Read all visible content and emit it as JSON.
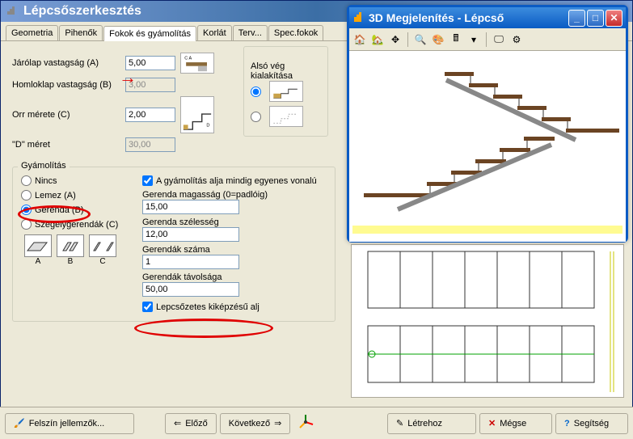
{
  "mainTitle": "Lépcsőszerkesztés",
  "tabs": [
    "Geometria",
    "Pihenők",
    "Fokok és gyámolítás",
    "Korlát",
    "Terv...",
    "Spec.fokok"
  ],
  "activeTab": 2,
  "fields": {
    "jarolap": {
      "label": "Járólap vastagság (A)",
      "value": "5,00"
    },
    "homloklap": {
      "label": "Homloklap vastagság (B)",
      "value": "3,00"
    },
    "orr": {
      "label": "Orr mérete (C)",
      "value": "2,00"
    },
    "dmeret": {
      "label": "\"D\" méret",
      "value": "30,00"
    }
  },
  "alsoveg": {
    "legend": "Alsó vég kialakítása"
  },
  "gyamolitas": {
    "legend": "Gyámolítás",
    "options": {
      "nincs": "Nincs",
      "lemez": "Lemez (A)",
      "gerenda": "Gerenda (B)",
      "szegely": "Szegélygerendák (C)"
    },
    "selected": "gerenda",
    "egyenes": {
      "label": "A gyámolítás alja mindig egyenes vonalú",
      "checked": true
    },
    "gerendaMagassag": {
      "label": "Gerenda magasság (0=padlóig)",
      "value": "15,00"
    },
    "gerendaSzelesseg": {
      "label": "Gerenda szélesség",
      "value": "12,00"
    },
    "gerendakSzama": {
      "label": "Gerendák száma",
      "value": "1"
    },
    "gerendakTav": {
      "label": "Gerendák távolsága",
      "value": "50,00"
    },
    "lepcsozetes": {
      "label": "Lepcsőzetes kiképzésű alj",
      "checked": true
    },
    "iconLabels": {
      "a": "A",
      "b": "B",
      "c": "C"
    }
  },
  "bottomButtons": {
    "felszin": "Felszín jellemzők...",
    "elozo": "Előző",
    "kovetkezo": "Következő",
    "letrehoz": "Létrehoz",
    "megse": "Mégse",
    "segitseg": "Segítség"
  },
  "previewTitle": "3D Megjelenítés - Lépcső"
}
